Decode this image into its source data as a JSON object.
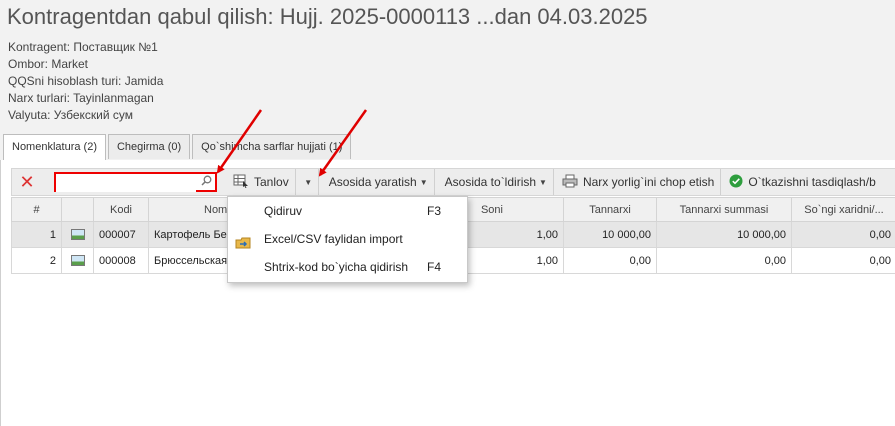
{
  "header": {
    "title": "Kontragentdan qabul qilish: Hujj. 2025-0000113 ...dan 04.03.2025",
    "info_lines": [
      "Kontragent: Поставщик №1",
      "Ombor: Market",
      "QQSni hisoblash turi: Jamida",
      "Narx turlari: Tayinlanmagan",
      "Valyuta: Узбекский сум"
    ]
  },
  "tabs": [
    {
      "label": "Nomenklatura (2)",
      "active": true
    },
    {
      "label": "Chegirma (0)",
      "active": false
    },
    {
      "label": "Qo`shimcha sarflar hujjati (1)",
      "active": false
    }
  ],
  "toolbar": {
    "close_glyph": "✕",
    "search_value": "",
    "search_icon": "search-icon",
    "tanlov_label": "Tanlov",
    "asosida_yaratish_label": "Asosida yaratish",
    "asosida_toldirish_label": "Asosida to`ldirish",
    "print_label": "Narx yorlig`ini chop etish",
    "confirm_label": "O`tkazishni tasdiqlash/b"
  },
  "grid": {
    "columns": [
      "#",
      "",
      "Kodi",
      "Nomi",
      "Soni",
      "Tannarxi",
      "Tannarxi summasi",
      "So`ngi xaridni/..."
    ],
    "rows": [
      {
        "index": "1",
        "code": "000007",
        "name": "Картофель Бе",
        "qty": "1,00",
        "cost": "10 000,00",
        "cost_sum": "10 000,00",
        "last": "0,00",
        "selected": true
      },
      {
        "index": "2",
        "code": "000008",
        "name": "Брюссельская",
        "qty": "1,00",
        "cost": "0,00",
        "cost_sum": "0,00",
        "last": "0,00",
        "selected": false
      }
    ]
  },
  "dropdown_menu": {
    "items": [
      {
        "label": "Qidiruv",
        "shortcut": "F3",
        "icon": ""
      },
      {
        "label": "Excel/CSV faylidan import",
        "shortcut": "",
        "icon": "import-icon"
      },
      {
        "label": "Shtrix-kod bo`yicha qidirish",
        "shortcut": "F4",
        "icon": ""
      }
    ]
  },
  "colors": {
    "highlight_red": "#e00000",
    "selected_row": "#e6e6e6",
    "confirm_green": "#2e9e3e"
  }
}
